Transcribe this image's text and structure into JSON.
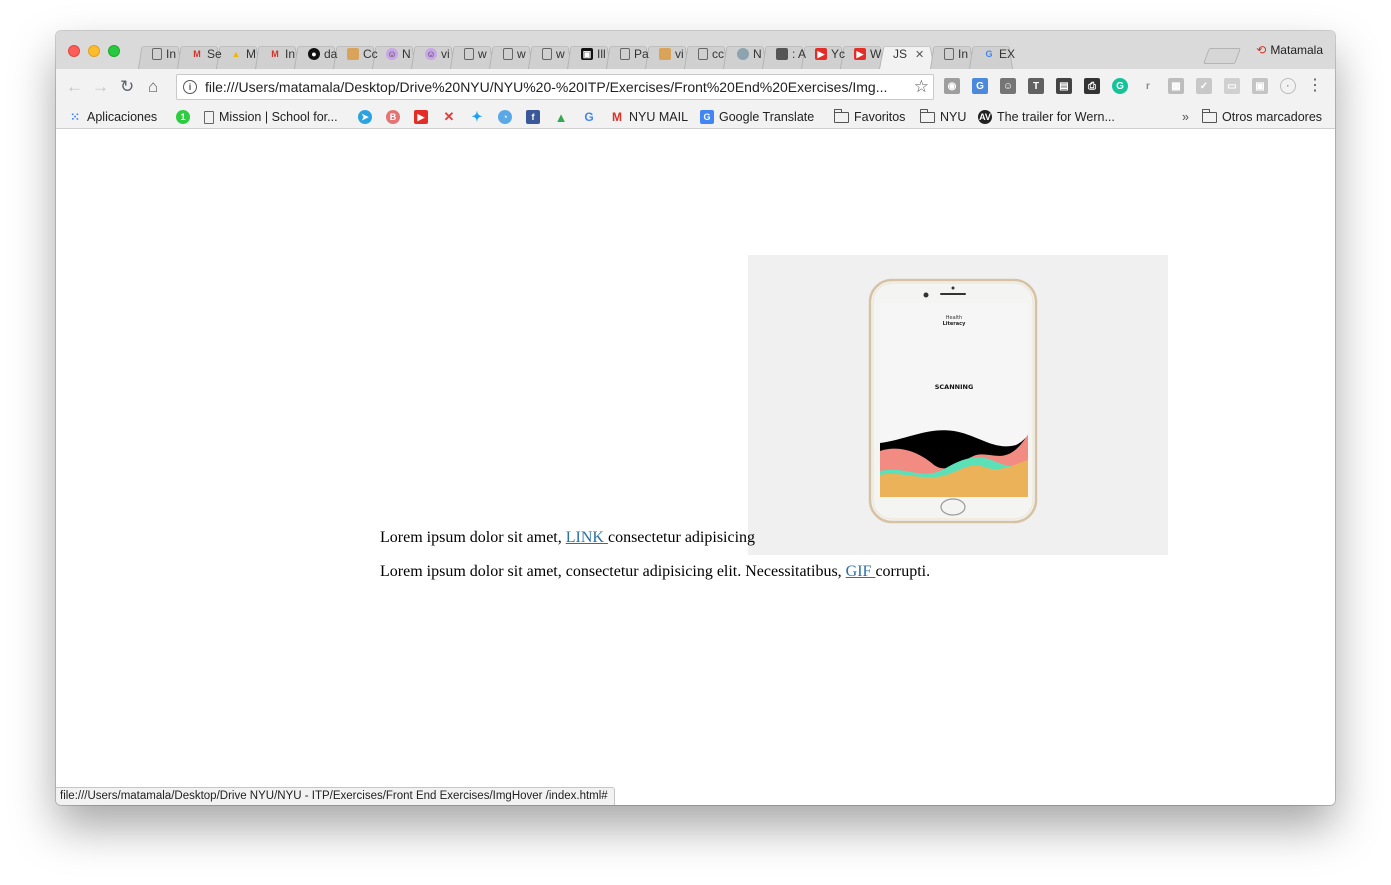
{
  "browser": {
    "profile_name": "Matamala",
    "url": "file:///Users/matamala/Desktop/Drive%20NYU/NYU%20-%20ITP/Exercises/Front%20End%20Exercises/Img...",
    "status_url": "file:///Users/matamala/Desktop/Drive NYU/NYU - ITP/Exercises/Front End Exercises/ImgHover /index.html#",
    "tabs": [
      {
        "label": "In",
        "icon": "page-icon"
      },
      {
        "label": "Se",
        "icon": "gmail-icon"
      },
      {
        "label": "M",
        "icon": "drive-icon"
      },
      {
        "label": "In",
        "icon": "gmail-icon"
      },
      {
        "label": "da",
        "icon": "bomb-icon"
      },
      {
        "label": "Cc",
        "icon": "image-icon"
      },
      {
        "label": "N",
        "icon": "avatar-icon"
      },
      {
        "label": "vi",
        "icon": "avatar-icon"
      },
      {
        "label": "w",
        "icon": "page-icon"
      },
      {
        "label": "w",
        "icon": "page-icon"
      },
      {
        "label": "w",
        "icon": "page-icon"
      },
      {
        "label": "Ill",
        "icon": "app-icon"
      },
      {
        "label": "Pa",
        "icon": "page-icon"
      },
      {
        "label": "vi",
        "icon": "image-icon"
      },
      {
        "label": "cc",
        "icon": "page-icon"
      },
      {
        "label": "N",
        "icon": "cloud-icon"
      },
      {
        "label": ": A",
        "icon": "square-icon"
      },
      {
        "label": "Yc",
        "icon": "youtube-icon"
      },
      {
        "label": "W",
        "icon": "youtube-icon"
      },
      {
        "label": "JS",
        "icon": "none",
        "active": true
      },
      {
        "label": "In",
        "icon": "page-icon"
      },
      {
        "label": "EX",
        "icon": "google-icon"
      }
    ],
    "bookmarks": {
      "apps": "Aplicaciones",
      "mission": "Mission | School for...",
      "nyu_mail": "NYU MAIL",
      "google_translate": "Google Translate",
      "favoritos": "Favoritos",
      "nyu": "NYU",
      "trailer": "The trailer for Wern...",
      "overflow": "»",
      "otros": "Otros marcadores"
    }
  },
  "page": {
    "para1_before": "Lorem ipsum dolor sit amet, ",
    "para1_link": "LINK ",
    "para1_after": "consectetur adipisicing",
    "para2_before": "Lorem ipsum dolor sit amet, consectetur adipisicing elit. Necessitatibus, ",
    "para2_link": "GIF ",
    "para2_after": "corrupti.",
    "phone": {
      "brand_line1": "Health",
      "brand_line2": "Literacy",
      "status": "SCANNING"
    }
  }
}
